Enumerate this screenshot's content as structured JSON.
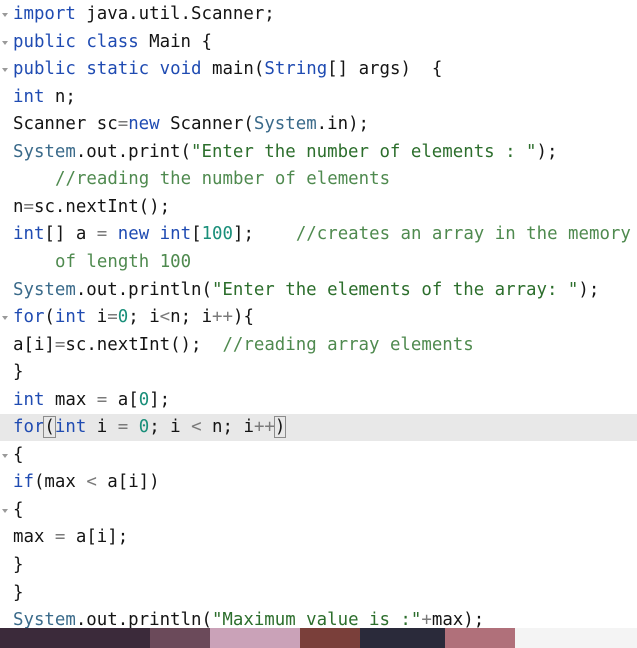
{
  "code_lines": [
    {
      "fold": true,
      "tokens": [
        {
          "t": "import",
          "c": "kw"
        },
        {
          "t": " java.util.Scanner;",
          "c": "pl"
        }
      ]
    },
    {
      "fold": true,
      "tokens": [
        {
          "t": "public",
          "c": "kw"
        },
        {
          "t": " ",
          "c": "pl"
        },
        {
          "t": "class",
          "c": "kw"
        },
        {
          "t": " Main {",
          "c": "pl"
        }
      ]
    },
    {
      "fold": true,
      "tokens": [
        {
          "t": "public",
          "c": "kw"
        },
        {
          "t": " ",
          "c": "pl"
        },
        {
          "t": "static",
          "c": "kw"
        },
        {
          "t": " ",
          "c": "pl"
        },
        {
          "t": "void",
          "c": "kw"
        },
        {
          "t": " main(",
          "c": "pl"
        },
        {
          "t": "String",
          "c": "ty"
        },
        {
          "t": "[] args)  {",
          "c": "pl"
        }
      ]
    },
    {
      "tokens": [
        {
          "t": "int",
          "c": "kw"
        },
        {
          "t": " n;",
          "c": "pl"
        }
      ]
    },
    {
      "tokens": [
        {
          "t": "Scanner sc",
          "c": "pl"
        },
        {
          "t": "=",
          "c": "op"
        },
        {
          "t": "new",
          "c": "kw"
        },
        {
          "t": " Scanner(",
          "c": "pl"
        },
        {
          "t": "System",
          "c": "sc"
        },
        {
          "t": ".in);",
          "c": "pl"
        }
      ]
    },
    {
      "tokens": [
        {
          "t": "System",
          "c": "sc"
        },
        {
          "t": ".out.print(",
          "c": "pl"
        },
        {
          "t": "\"Enter the number of elements : \"",
          "c": "str"
        },
        {
          "t": ");",
          "c": "pl"
        }
      ]
    },
    {
      "indent": true,
      "tokens": [
        {
          "t": "//reading the number of elements",
          "c": "cm"
        }
      ]
    },
    {
      "tokens": [
        {
          "t": "n",
          "c": "pl"
        },
        {
          "t": "=",
          "c": "op"
        },
        {
          "t": "sc.nextInt();",
          "c": "pl"
        }
      ]
    },
    {
      "tokens": [
        {
          "t": "int",
          "c": "kw"
        },
        {
          "t": "[] a ",
          "c": "pl"
        },
        {
          "t": "=",
          "c": "op"
        },
        {
          "t": " ",
          "c": "pl"
        },
        {
          "t": "new",
          "c": "kw"
        },
        {
          "t": " ",
          "c": "pl"
        },
        {
          "t": "int",
          "c": "kw"
        },
        {
          "t": "[",
          "c": "pl"
        },
        {
          "t": "100",
          "c": "num"
        },
        {
          "t": "];    ",
          "c": "pl"
        },
        {
          "t": "//creates an array in the memory",
          "c": "cm"
        }
      ]
    },
    {
      "indent": true,
      "tokens": [
        {
          "t": "of length 100",
          "c": "cm"
        }
      ]
    },
    {
      "tokens": [
        {
          "t": "System",
          "c": "sc"
        },
        {
          "t": ".out.println(",
          "c": "pl"
        },
        {
          "t": "\"Enter the elements of the array: \"",
          "c": "str"
        },
        {
          "t": ");",
          "c": "pl"
        }
      ]
    },
    {
      "fold": true,
      "tokens": [
        {
          "t": "for",
          "c": "kw"
        },
        {
          "t": "(",
          "c": "pl"
        },
        {
          "t": "int",
          "c": "kw"
        },
        {
          "t": " i",
          "c": "pl"
        },
        {
          "t": "=",
          "c": "op"
        },
        {
          "t": "0",
          "c": "num"
        },
        {
          "t": "; i",
          "c": "pl"
        },
        {
          "t": "<",
          "c": "op"
        },
        {
          "t": "n; i",
          "c": "pl"
        },
        {
          "t": "++",
          "c": "op"
        },
        {
          "t": "){",
          "c": "pl"
        }
      ]
    },
    {
      "tokens": [
        {
          "t": "a[i]",
          "c": "pl"
        },
        {
          "t": "=",
          "c": "op"
        },
        {
          "t": "sc.nextInt();  ",
          "c": "pl"
        },
        {
          "t": "//reading array elements",
          "c": "cm"
        }
      ]
    },
    {
      "tokens": [
        {
          "t": "}",
          "c": "pl"
        }
      ]
    },
    {
      "tokens": [
        {
          "t": "int",
          "c": "kw"
        },
        {
          "t": " max ",
          "c": "pl"
        },
        {
          "t": "=",
          "c": "op"
        },
        {
          "t": " a[",
          "c": "pl"
        },
        {
          "t": "0",
          "c": "num"
        },
        {
          "t": "];",
          "c": "pl"
        }
      ]
    },
    {
      "highlight": true,
      "tokens": [
        {
          "t": "for",
          "c": "kw"
        },
        {
          "t": "(",
          "c": "pl brk"
        },
        {
          "t": "int",
          "c": "kw"
        },
        {
          "t": " i ",
          "c": "pl"
        },
        {
          "t": "=",
          "c": "op"
        },
        {
          "t": " ",
          "c": "pl"
        },
        {
          "t": "0",
          "c": "num"
        },
        {
          "t": "; i ",
          "c": "pl"
        },
        {
          "t": "<",
          "c": "op"
        },
        {
          "t": " n; i",
          "c": "pl"
        },
        {
          "t": "++",
          "c": "op"
        },
        {
          "t": ")",
          "c": "pl brk"
        }
      ]
    },
    {
      "fold": true,
      "tokens": [
        {
          "t": "{",
          "c": "pl"
        }
      ]
    },
    {
      "tokens": [
        {
          "t": "if",
          "c": "kw"
        },
        {
          "t": "(max ",
          "c": "pl"
        },
        {
          "t": "<",
          "c": "op"
        },
        {
          "t": " a[i])",
          "c": "pl"
        }
      ]
    },
    {
      "fold": true,
      "tokens": [
        {
          "t": "{",
          "c": "pl"
        }
      ]
    },
    {
      "tokens": [
        {
          "t": "max ",
          "c": "pl"
        },
        {
          "t": "=",
          "c": "op"
        },
        {
          "t": " a[i];",
          "c": "pl"
        }
      ]
    },
    {
      "tokens": [
        {
          "t": "}",
          "c": "pl"
        }
      ]
    },
    {
      "tokens": [
        {
          "t": "}",
          "c": "pl"
        }
      ]
    },
    {
      "tokens": [
        {
          "t": "System",
          "c": "sc"
        },
        {
          "t": ".out.println(",
          "c": "pl"
        },
        {
          "t": "\"Maximum value is :\"",
          "c": "str"
        },
        {
          "t": "+",
          "c": "op"
        },
        {
          "t": "max);",
          "c": "pl"
        }
      ]
    }
  ],
  "colors": {
    "keyword": "#1f4bb2",
    "number": "#1a8f7a",
    "string": "#2c6e2c",
    "comment": "#4f8a4f",
    "operator": "#7a7a7a",
    "highlight_line": "#e8e8e8"
  },
  "photo_strip_colors": [
    "#3b2a3a",
    "#6b4a5a",
    "#caa2b8",
    "#7a3f3a",
    "#2a2a3a",
    "#b0707a",
    "#f4f4f4"
  ]
}
